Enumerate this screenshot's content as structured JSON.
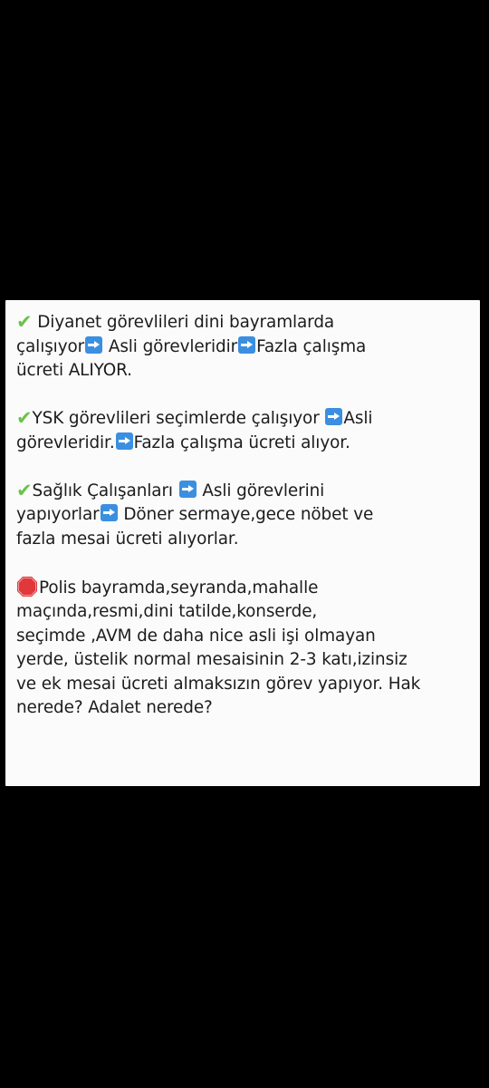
{
  "colors": {
    "background": "#000000",
    "card": "#fbfbfb",
    "text": "#1c1c1c",
    "check": "#6cc24a",
    "arrow": "#3b8fe0",
    "stop": "#e0383b"
  },
  "paragraphs": [
    {
      "icon": "check-mark-icon",
      "l1": " Diyanet görevlileri dini bayramlarda",
      "l2a": "çalışıyor",
      "l2b": " Asli görevleridir",
      "l2c": "Fazla çalışma",
      "l3": "ücreti ALIYOR."
    },
    {
      "icon": "check-mark-icon",
      "l1a": "YSK görevlileri seçimlerde çalışıyor ",
      "l1b": "Asli",
      "l2a": "görevleridir.",
      "l2b": "Fazla çalışma ücreti alıyor."
    },
    {
      "icon": "check-mark-icon",
      "l1a": "Sağlık Çalışanları ",
      "l1b": " Asli görevlerini",
      "l2a": "yapıyorlar",
      "l2b": " Döner sermaye,gece nöbet ve",
      "l3": "fazla mesai ücreti alıyorlar."
    },
    {
      "icon": "stop-sign-icon",
      "l1": "Polis bayramda,seyranda,mahalle",
      "l2": "maçında,resmi,dini tatilde,konserde,",
      "l3": "seçimde ,AVM de daha nice asli işi olmayan",
      "l4": "yerde, üstelik normal mesaisinin 2-3 katı,izinsiz",
      "l5": "ve ek mesai ücreti almaksızın görev yapıyor. Hak",
      "l6": "nerede? Adalet nerede?"
    }
  ]
}
